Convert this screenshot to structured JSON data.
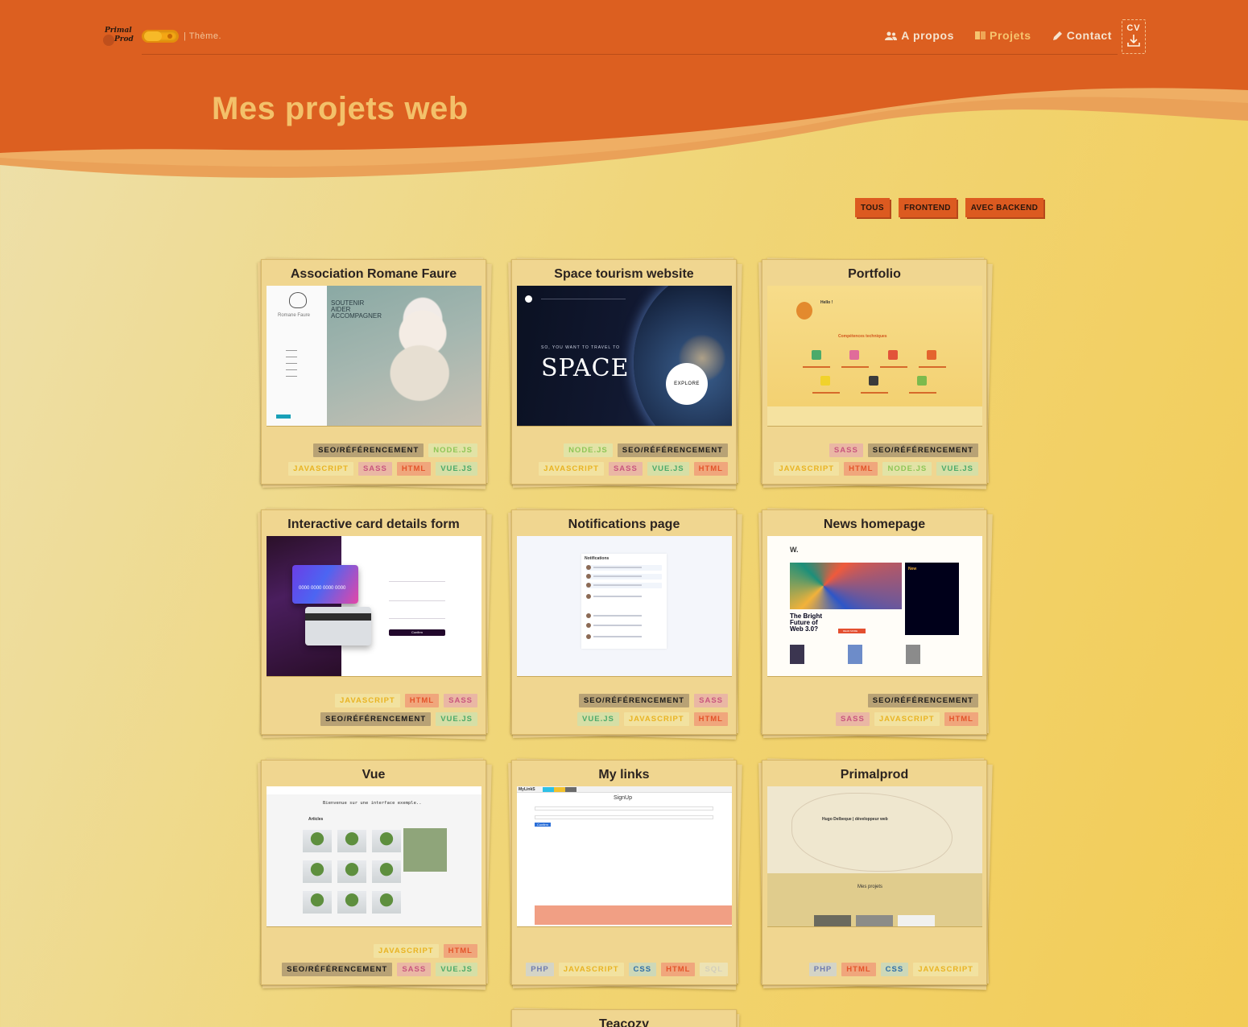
{
  "header": {
    "logo": [
      "Primal",
      "Prod"
    ],
    "theme_label": "| Thème.",
    "nav": [
      {
        "label": "A propos",
        "icon": "users-icon"
      },
      {
        "label": "Projets",
        "icon": "book-icon",
        "active": true
      },
      {
        "label": "Contact",
        "icon": "pencil-icon"
      }
    ],
    "cv_label": "CV"
  },
  "page_title": "Mes projets web",
  "filters": [
    "TOUS",
    "FRONTEND",
    "AVEC BACKEND"
  ],
  "projects": [
    {
      "title": "Association Romane Faure",
      "tags": [
        "JAVASCRIPT",
        "SASS",
        "HTML",
        "VUE.JS",
        "SEO/RÉFÉRENCEMENT",
        "NODE.JS"
      ]
    },
    {
      "title": "Space tourism website",
      "tags": [
        "JAVASCRIPT",
        "SASS",
        "VUE.JS",
        "HTML",
        "NODE.JS",
        "SEO/RÉFÉRENCEMENT"
      ]
    },
    {
      "title": "Portfolio",
      "tags": [
        "JAVASCRIPT",
        "HTML",
        "NODE.JS",
        "VUE.JS",
        "SASS",
        "SEO/RÉFÉRENCEMENT"
      ]
    },
    {
      "title": "Interactive card details form",
      "tags": [
        "SEO/RÉFÉRENCEMENT",
        "VUE.JS",
        "JAVASCRIPT",
        "HTML",
        "SASS"
      ]
    },
    {
      "title": "Notifications page",
      "tags": [
        "VUE.JS",
        "JAVASCRIPT",
        "HTML",
        "SEO/RÉFÉRENCEMENT",
        "SASS"
      ]
    },
    {
      "title": "News homepage",
      "tags": [
        "SASS",
        "JAVASCRIPT",
        "HTML",
        "SEO/RÉFÉRENCEMENT"
      ]
    },
    {
      "title": "Vue",
      "tags": [
        "SEO/RÉFÉRENCEMENT",
        "SASS",
        "VUE.JS",
        "JAVASCRIPT",
        "HTML"
      ]
    },
    {
      "title": "My links",
      "tags": [
        "PHP",
        "JAVASCRIPT",
        "CSS",
        "HTML",
        "SQL"
      ]
    },
    {
      "title": "Primalprod",
      "tags": [
        "PHP",
        "HTML",
        "CSS",
        "JAVASCRIPT"
      ]
    },
    {
      "title": "Teacozy",
      "tags": []
    }
  ],
  "thumbs": {
    "romane": {
      "lines": [
        "SOUTENIR",
        "AIDER",
        "ACCOMPAGNER"
      ],
      "name": "Romane Faure"
    },
    "space": {
      "small": "SO, YOU WANT TO TRAVEL TO",
      "big": "SPACE",
      "button": "EXPLORE"
    },
    "portfolio": {
      "hello": "Hello !",
      "skills": "Compétences techniques"
    },
    "card": {
      "number": "0000 0000 0000 0000",
      "button": "Confirm"
    },
    "notif": {
      "title": "Notifications"
    },
    "news": {
      "logo": "W.",
      "headline": "The Bright Future of Web 3.0?",
      "new": "New",
      "button": "READ MORE"
    },
    "vue": {
      "welcome": "Bienvenue sur une interface exemple..",
      "articles": "Articles"
    },
    "links": {
      "brand": "MyLinkS",
      "heading": "SignUp",
      "button": "Confirm"
    },
    "primal": {
      "name": "Hugo Delbeque | développeur web",
      "section": "Mes projets"
    }
  },
  "colors": {
    "header": "#dc5f20",
    "title": "#f3c16a",
    "filter": "#dc5a20"
  }
}
